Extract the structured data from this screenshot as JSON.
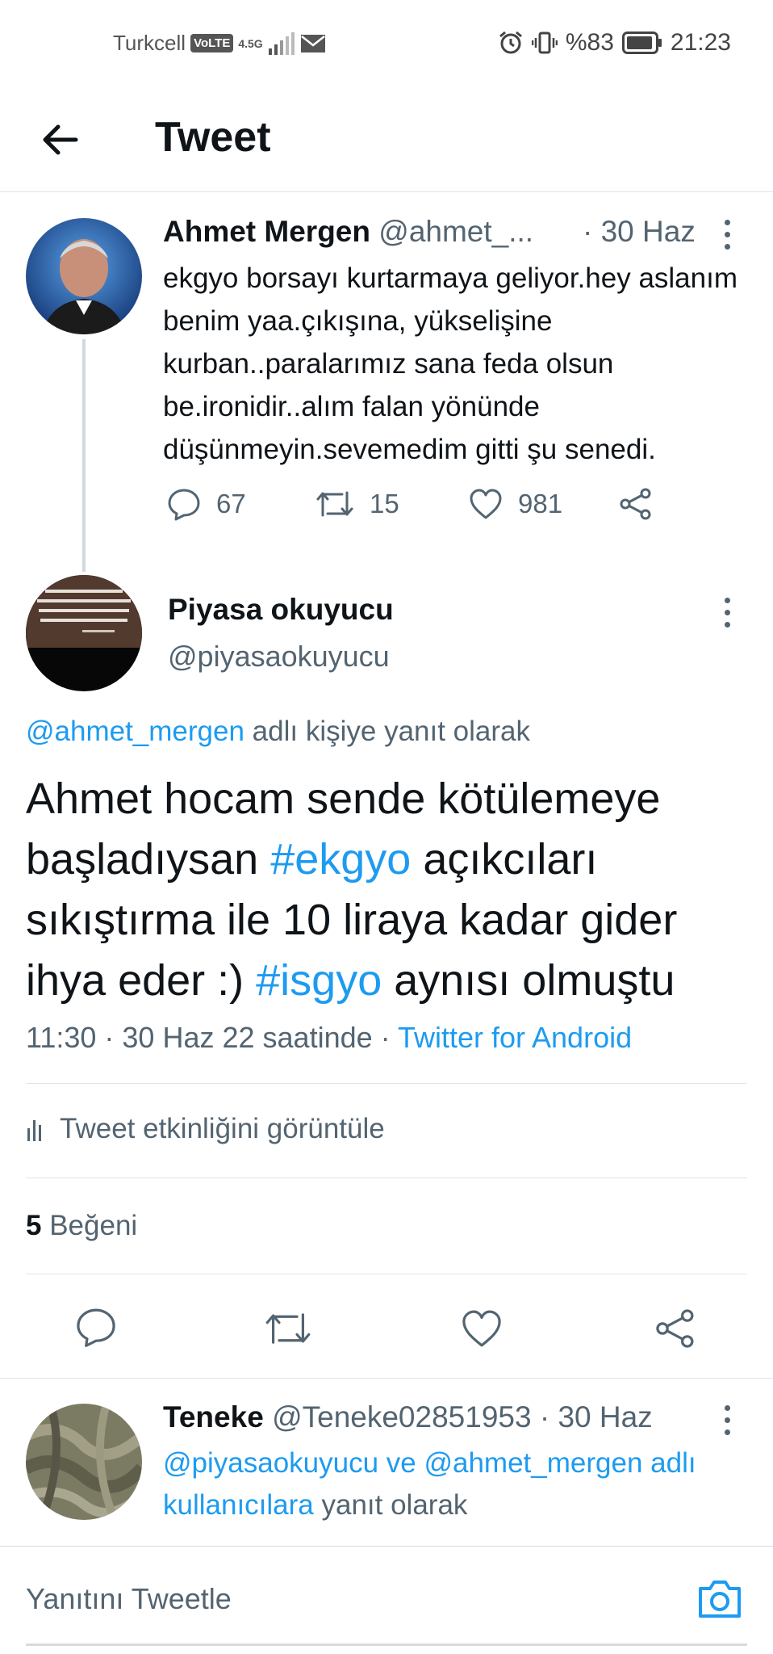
{
  "status_bar": {
    "carrier": "Turkcell",
    "volte": "VoLTE",
    "network": "4.5G",
    "battery": "%83",
    "time": "21:23"
  },
  "header": {
    "title": "Tweet"
  },
  "parent_tweet": {
    "name": "Ahmet Mergen",
    "handle": "@ahmet_...",
    "date": "· 30 Haz",
    "text": "ekgyo borsayı kurtarmaya geliyor.hey aslanım benim yaa.çıkışına, yükselişine kurban..paralarımız sana feda olsun be.ironidir..alım falan yönünde düşünmeyin.sevemedim gitti şu senedi.",
    "replies": "67",
    "retweets": "15",
    "likes": "981"
  },
  "main_tweet": {
    "name": "Piyasa okuyucu",
    "handle": "@piyasaokuyucu",
    "reply_to_handle": "@ahmet_mergen",
    "reply_to_suffix": " adlı kişiye yanıt olarak",
    "text_part1": "Ahmet hocam sende kötülemeye başladıysan ",
    "hashtag1": "#ekgyo",
    "text_part2": " açıkcıları sıkıştırma ile 10 liraya kadar gider ihya eder :) ",
    "hashtag2": "#isgyo",
    "text_part3": " aynısı olmuştu",
    "time_date": "11:30 · 30 Haz 22 saatinde ·",
    "source": "Twitter for Android",
    "activity_label": "Tweet etkinliğini görüntüle",
    "like_count": "5",
    "like_label": "Beğeni"
  },
  "reply_tweet": {
    "name": "Teneke",
    "handle": "@Teneke02851953",
    "date": "· 30 Haz",
    "reply_to_links": "@piyasaokuyucu ve @ahmet_mergen adlı kullanıcılara",
    "reply_to_suffix": " yanıt olarak"
  },
  "compose": {
    "placeholder": "Yanıtını Tweetle"
  },
  "colors": {
    "accent": "#1d9bf0",
    "text": "#0f1419",
    "muted": "#536471",
    "divider": "#e1e5e8"
  }
}
